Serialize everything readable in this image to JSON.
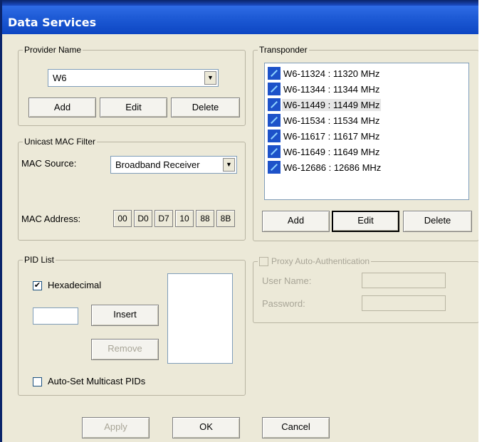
{
  "window": {
    "title": "Data Services"
  },
  "provider": {
    "legend": "Provider Name",
    "selected": "W6",
    "add": "Add",
    "edit": "Edit",
    "delete": "Delete"
  },
  "mac_filter": {
    "legend": "Unicast MAC Filter",
    "source_label": "MAC Source:",
    "source_value": "Broadband Receiver",
    "address_label": "MAC Address:",
    "address_octets": [
      "00",
      "D0",
      "D7",
      "10",
      "88",
      "8B"
    ]
  },
  "pid_list": {
    "legend": "PID List",
    "hex_label": "Hexadecimal",
    "hex_checked": true,
    "insert": "Insert",
    "remove": "Remove",
    "auto_set_label": "Auto-Set Multicast PIDs",
    "auto_set_checked": false
  },
  "transponder": {
    "legend": "Transponder",
    "items": [
      "W6-11324 : 11320 MHz",
      "W6-11344 : 11344 MHz",
      "W6-11449 : 11449 MHz",
      "W6-11534 : 11534 MHz",
      "W6-11617 : 11617 MHz",
      "W6-11649 : 11649 MHz",
      "W6-12686 : 12686 MHz"
    ],
    "selected_index": 2,
    "add": "Add",
    "edit": "Edit",
    "delete": "Delete"
  },
  "proxy": {
    "legend": "Proxy Auto-Authentication",
    "user_label": "User Name:",
    "password_label": "Password:"
  },
  "footer": {
    "apply": "Apply",
    "ok": "OK",
    "cancel": "Cancel"
  },
  "colors": {
    "title_bar": "#1e5bd6",
    "dialog_bg": "#ece9d8",
    "item_icon": "#1d52c9"
  }
}
